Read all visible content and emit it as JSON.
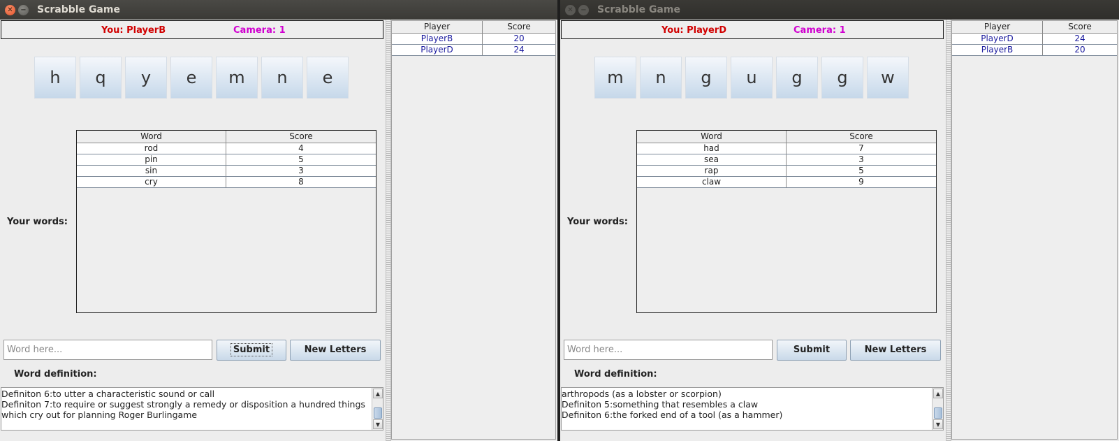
{
  "windows": [
    {
      "title": "Scrabble Game",
      "you_label": "You: PlayerB",
      "camera_label": "Camera: 1",
      "tiles": [
        "h",
        "q",
        "y",
        "e",
        "m",
        "n",
        "e"
      ],
      "words_label": "Your words:",
      "words_table": {
        "headers": [
          "Word",
          "Score"
        ],
        "rows": [
          [
            "rod",
            "4"
          ],
          [
            "pin",
            "5"
          ],
          [
            "sin",
            "3"
          ],
          [
            "cry",
            "8"
          ]
        ]
      },
      "word_input_placeholder": "Word here...",
      "submit_label": "Submit",
      "new_letters_label": "New Letters",
      "definition_label": "Word definition:",
      "definition_text": "Definiton 6:to utter a characteristic sound or call\nDefiniton 7:to require or suggest strongly a remedy or disposition a hundred things which cry out for planning Roger Burlingame",
      "scoreboard": {
        "headers": [
          "Player",
          "Score"
        ],
        "rows": [
          [
            "PlayerB",
            "20"
          ],
          [
            "PlayerD",
            "24"
          ]
        ]
      }
    },
    {
      "title": "Scrabble Game",
      "you_label": "You: PlayerD",
      "camera_label": "Camera: 1",
      "tiles": [
        "m",
        "n",
        "g",
        "u",
        "g",
        "g",
        "w"
      ],
      "words_label": "Your words:",
      "words_table": {
        "headers": [
          "Word",
          "Score"
        ],
        "rows": [
          [
            "had",
            "7"
          ],
          [
            "sea",
            "3"
          ],
          [
            "rap",
            "5"
          ],
          [
            "claw",
            "9"
          ]
        ]
      },
      "word_input_placeholder": "Word here...",
      "submit_label": "Submit",
      "new_letters_label": "New Letters",
      "definition_label": "Word definition:",
      "definition_text": "arthropods (as a lobster or scorpion)\nDefiniton 5:something that resembles a claw\nDefiniton 6:the forked end of a tool (as a hammer)",
      "scoreboard": {
        "headers": [
          "Player",
          "Score"
        ],
        "rows": [
          [
            "PlayerD",
            "24"
          ],
          [
            "PlayerB",
            "20"
          ]
        ]
      }
    }
  ],
  "colors": {
    "you_label": "#d10000",
    "camera_label": "#d000d0",
    "scoreboard_text": "#1a1a9e",
    "tile_gradient_top": "#f4f7fb",
    "tile_gradient_bottom": "#c6d8ea"
  }
}
